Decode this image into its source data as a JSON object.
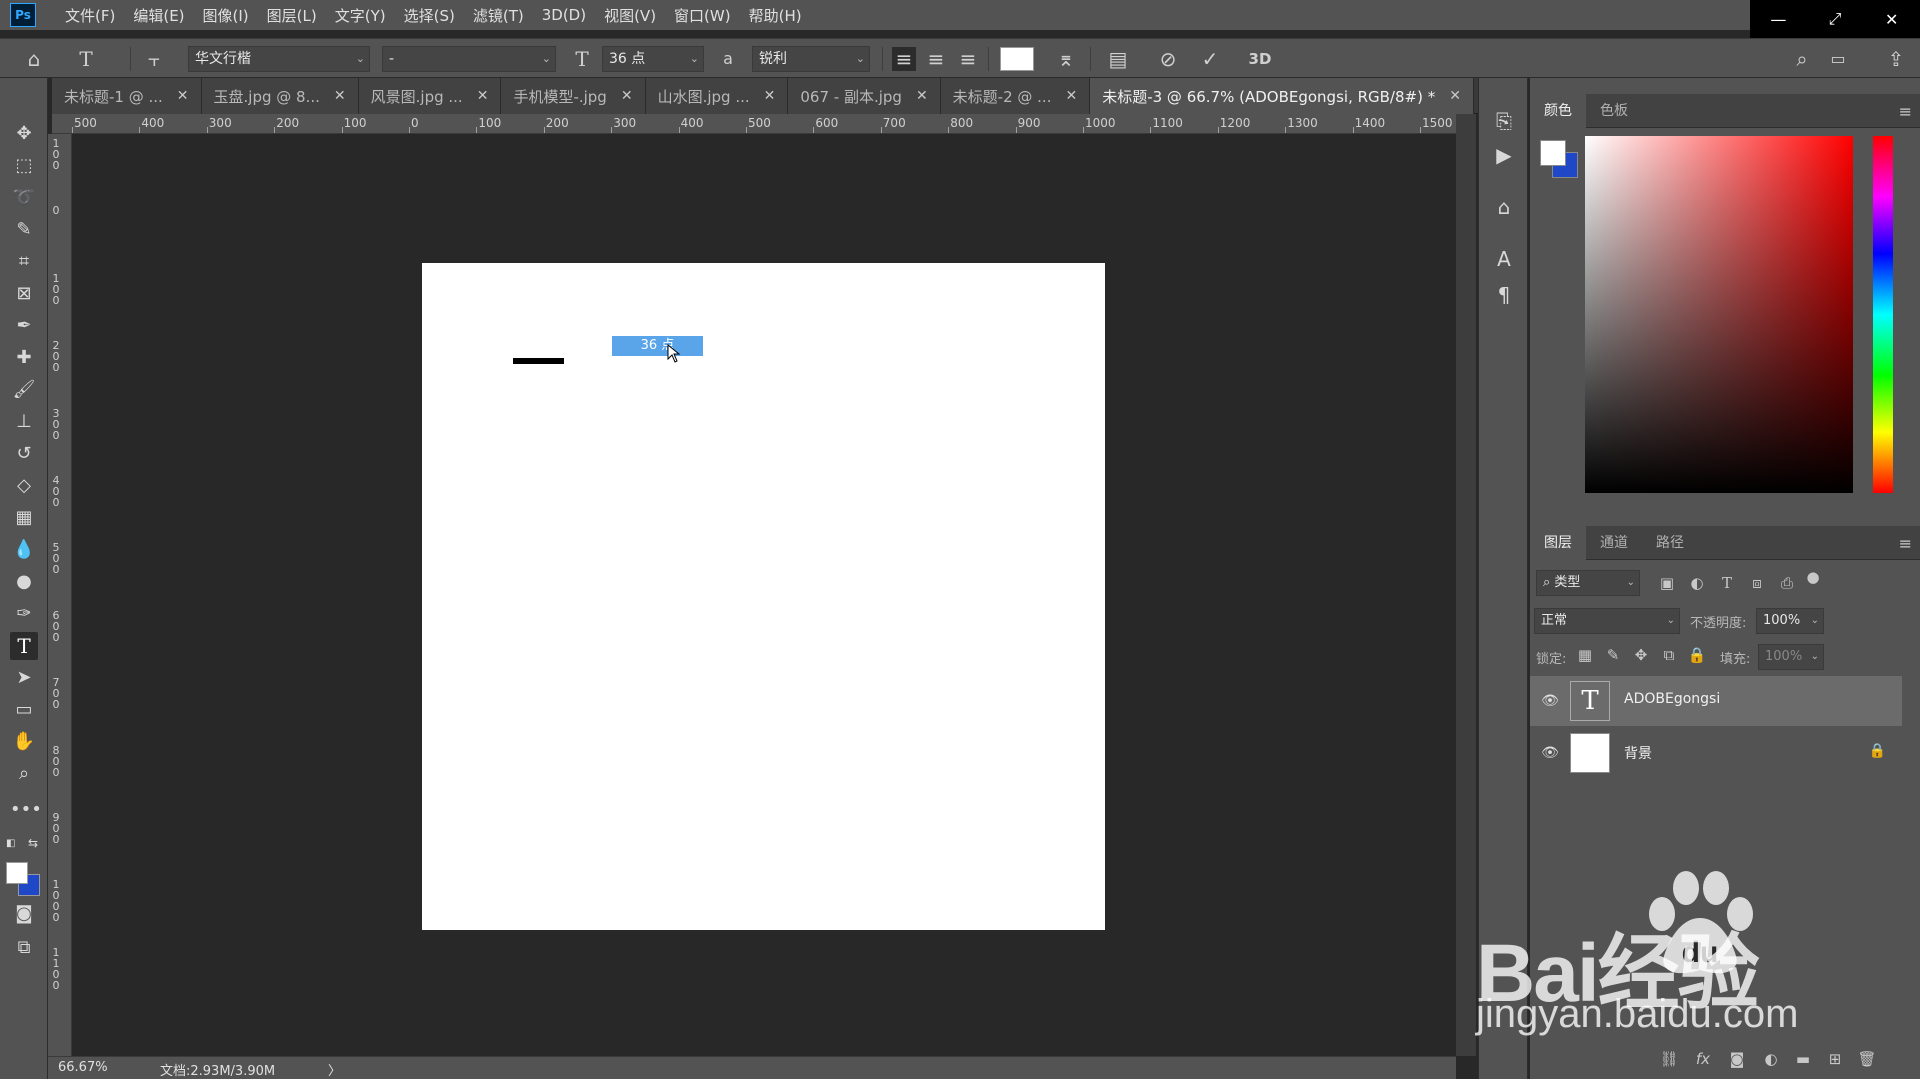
{
  "menubar": {
    "logo": "Ps",
    "items": [
      "文件(F)",
      "编辑(E)",
      "图像(I)",
      "图层(L)",
      "文字(Y)",
      "选择(S)",
      "滤镜(T)",
      "3D(D)",
      "视图(V)",
      "窗口(W)",
      "帮助(H)"
    ]
  },
  "window_controls": {
    "minimize": "—",
    "restore": "⤢",
    "close": "✕"
  },
  "options": {
    "font_family": "华文行楷",
    "font_style": "-",
    "font_size": "36 点",
    "aa_label": "a",
    "antialias": "锐利",
    "three_d": "3D"
  },
  "tabs": [
    {
      "label": "未标题-1 @ ...",
      "active": false
    },
    {
      "label": "玉盘.jpg @ 8...",
      "active": false
    },
    {
      "label": "风景图.jpg ...",
      "active": false
    },
    {
      "label": "手机模型-.jpg",
      "active": false
    },
    {
      "label": "山水图.jpg ...",
      "active": false
    },
    {
      "label": "067 - 副本.jpg",
      "active": false
    },
    {
      "label": "未标题-2 @ ...",
      "active": false
    },
    {
      "label": "未标题-3 @ 66.7% (ADOBEgongsi, RGB/8#) *",
      "active": true
    }
  ],
  "ruler_top": [
    "500",
    "400",
    "300",
    "200",
    "100",
    "0",
    "100",
    "200",
    "300",
    "400",
    "500",
    "600",
    "700",
    "800",
    "900",
    "1000",
    "1100",
    "1200",
    "1300",
    "1400",
    "1500"
  ],
  "ruler_left": [
    "1 0 0",
    "0",
    "1 0 0",
    "2 0 0",
    "3 0 0",
    "4 0 0",
    "5 0 0",
    "6 0 0",
    "7 0 0",
    "8 0 0",
    "9 0 0",
    "1 0 0 0",
    "1 1 0 0"
  ],
  "canvas": {
    "size_tooltip": "36 点"
  },
  "status": {
    "zoom": "66.67%",
    "doc": "文档:2.93M/3.90M",
    "arrow": "〉"
  },
  "color_panel": {
    "tabs": [
      "颜色",
      "色板"
    ]
  },
  "layers_panel": {
    "tabs": [
      "图层",
      "通道",
      "路径"
    ],
    "filter_placeholder": "类型",
    "blend_mode": "正常",
    "opacity_label": "不透明度:",
    "opacity_value": "100%",
    "lock_label": "锁定:",
    "fill_label": "填充:",
    "fill_value": "100%",
    "layers": [
      {
        "name": "ADOBEgongsi",
        "type": "text",
        "thumb": "T",
        "selected": true
      },
      {
        "name": "背景",
        "type": "raster",
        "thumb": "",
        "selected": false,
        "locked": true
      }
    ]
  },
  "watermark": {
    "brand": "Bai⁠经验",
    "url": "jingyan.baidu.com"
  },
  "colors": {
    "ui_bg": "#535353",
    "canvas_bg": "#282828",
    "accent": "#5aa5ea",
    "bg_swatch": "#1f48c8"
  }
}
